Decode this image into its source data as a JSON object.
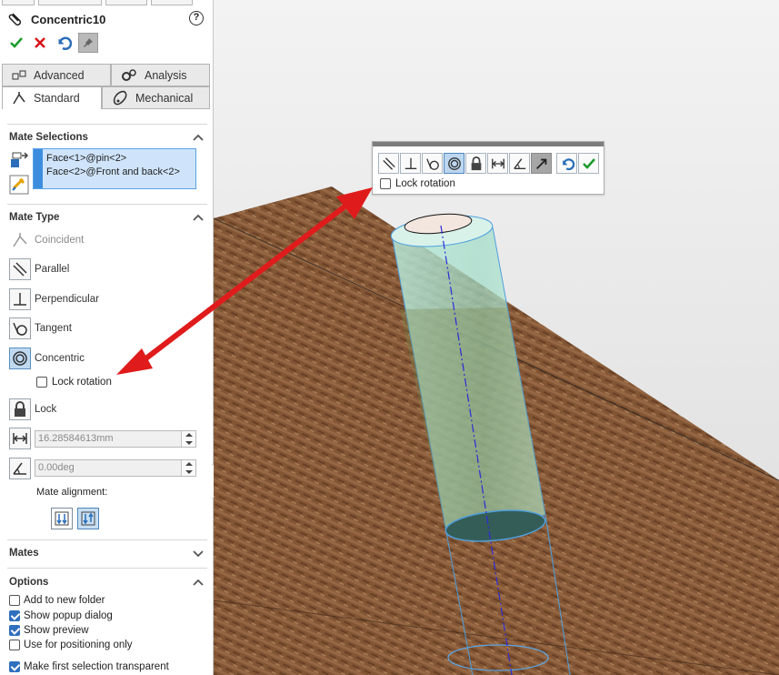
{
  "panel": {
    "title": "Concentric10",
    "help_icon": "?",
    "tabs": {
      "advanced": "Advanced",
      "analysis": "Analysis",
      "standard": "Standard",
      "mechanical": "Mechanical"
    },
    "mate_selections": {
      "header": "Mate Selections",
      "items": [
        "Face<1>@pin<2>",
        "Face<2>@Front and back<2>"
      ]
    },
    "mate_type": {
      "header": "Mate Type",
      "coincident": "Coincident",
      "parallel": "Parallel",
      "perpendicular": "Perpendicular",
      "tangent": "Tangent",
      "concentric": "Concentric",
      "lock_rotation": "Lock rotation",
      "lock": "Lock",
      "distance_value": "16.28584613mm",
      "angle_value": "0.00deg",
      "mate_alignment": "Mate alignment:"
    },
    "mates_header": "Mates",
    "options": {
      "header": "Options",
      "add_to_new_folder": "Add to new folder",
      "show_popup_dialog": "Show popup dialog",
      "show_preview": "Show preview",
      "use_for_positioning_only": "Use for positioning only",
      "make_first_selection_transparent": "Make first selection transparent"
    }
  },
  "popup": {
    "lock_rotation": "Lock rotation"
  },
  "colors": {
    "accept": "#1a9b2a",
    "cancel": "#d8121b",
    "selection_fill": "#cfe4fa",
    "selection_border": "#5aa3e8",
    "annotation_arrow": "#e01b1b",
    "preview_solid": "#a8e0cc"
  }
}
